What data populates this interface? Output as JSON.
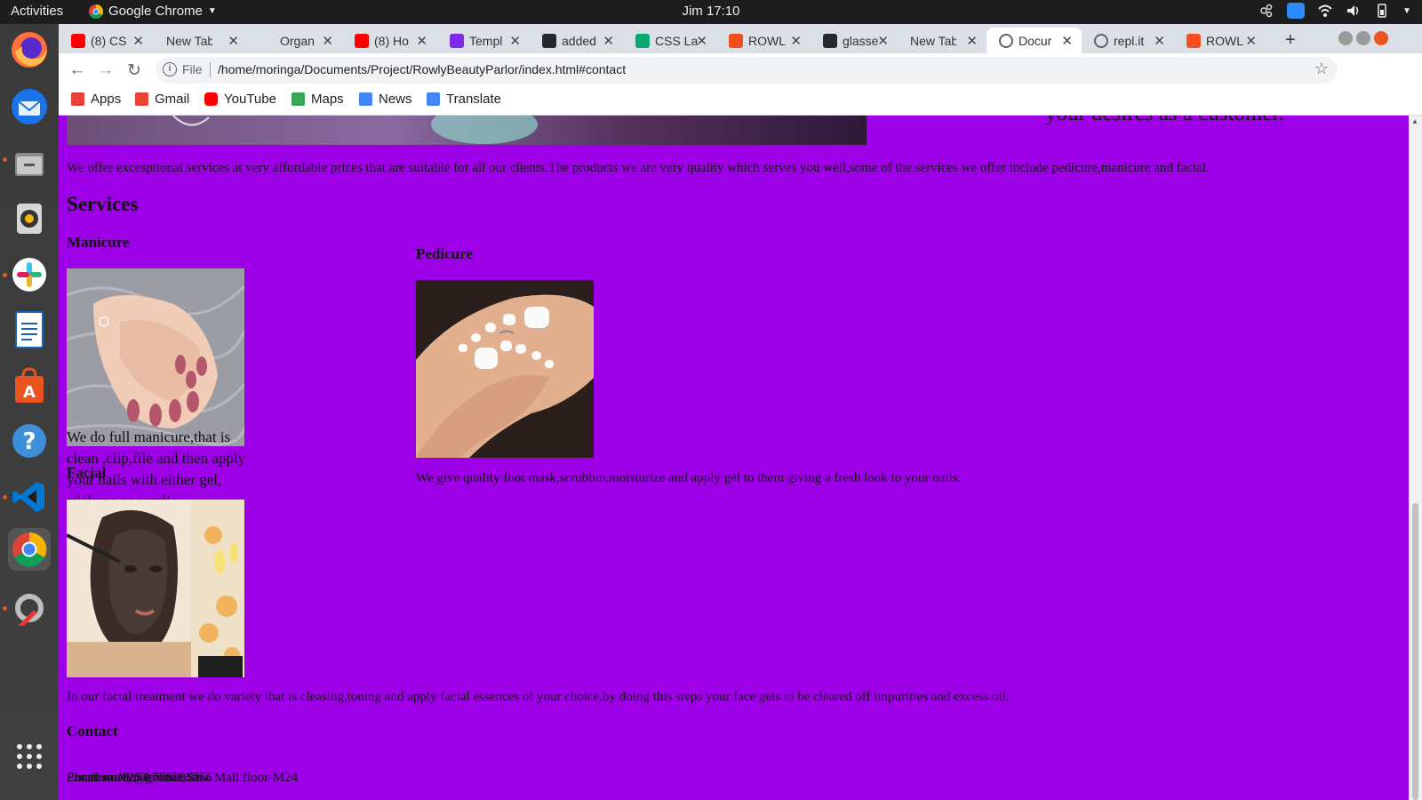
{
  "desktop": {
    "activities": "Activities",
    "app_name": "Google Chrome",
    "clock": "Jim 17:10"
  },
  "browser": {
    "tabs": [
      {
        "title": "(8) CS",
        "icon": "youtube-icon",
        "color": "#ff0000"
      },
      {
        "title": "New Tab",
        "icon": "none",
        "color": "#dbe0e6"
      },
      {
        "title": "Organ",
        "icon": "blank-page-icon",
        "color": "#dbe0e6"
      },
      {
        "title": "(8) Ho",
        "icon": "youtube-icon",
        "color": "#ff0000"
      },
      {
        "title": "Templ",
        "icon": "canva-icon",
        "color": "#7d2ae8"
      },
      {
        "title": "added",
        "icon": "github-icon",
        "color": "#24292e"
      },
      {
        "title": "CSS La",
        "icon": "w3schools-icon",
        "color": "#04aa6d"
      },
      {
        "title": "ROWL",
        "icon": "figma-icon",
        "color": "#f24e1e"
      },
      {
        "title": "glasse",
        "icon": "github-icon",
        "color": "#24292e"
      },
      {
        "title": "New Tab",
        "icon": "none",
        "color": "#dbe0e6"
      },
      {
        "title": "Docur",
        "icon": "globe-icon",
        "color": "#5f6368"
      },
      {
        "title": "repl.it",
        "icon": "replit-icon",
        "color": "#5f6368"
      },
      {
        "title": "ROWL",
        "icon": "figma-icon",
        "color": "#f24e1e"
      }
    ],
    "address": {
      "scheme": "File",
      "url": "/home/moringa/Documents/Project/RowlyBeautyParlor/index.html#contact"
    },
    "bookmarks": [
      {
        "label": "Apps",
        "icon": "apps-grid-icon"
      },
      {
        "label": "Gmail",
        "icon": "gmail-icon"
      },
      {
        "label": "YouTube",
        "icon": "youtube-icon"
      },
      {
        "label": "Maps",
        "icon": "maps-icon"
      },
      {
        "label": "News",
        "icon": "news-icon"
      },
      {
        "label": "Translate",
        "icon": "translate-icon"
      }
    ]
  },
  "page": {
    "background_color": "#9d00e6",
    "hero_text_fragment": "your desires as a customer.",
    "intro": "We offer excesptional services at very affordable prices that are suitable for all our clients.The products we are very quality which serves you well,some of the services we offer include pedicure,manicure and facial.",
    "services_heading": "Services",
    "manicure": {
      "heading": "Manicure",
      "text": "We do full manicure,that is clean ,clip,file and then apply your nails with either gel, stickons or acrylic."
    },
    "pedicure": {
      "heading": "Pedicure",
      "text": "We give quality foot mask,scrubbin,moisturize and apply gel to them giving a fresh look to your nails."
    },
    "facial": {
      "heading": "Facial",
      "text": "In our facial treatment we do variety that is cleasing,toning and apply facial essences of your choice,by doing this steps your face gets to be cleared off impurities and excess oil."
    },
    "contact_heading": "Contact",
    "contact_lines": [
      "Phone no:+254-778897766",
      "Location:Moi Avenue,Sasa Mall floor-M24",
      "Email:rowly@gmail.com"
    ]
  }
}
